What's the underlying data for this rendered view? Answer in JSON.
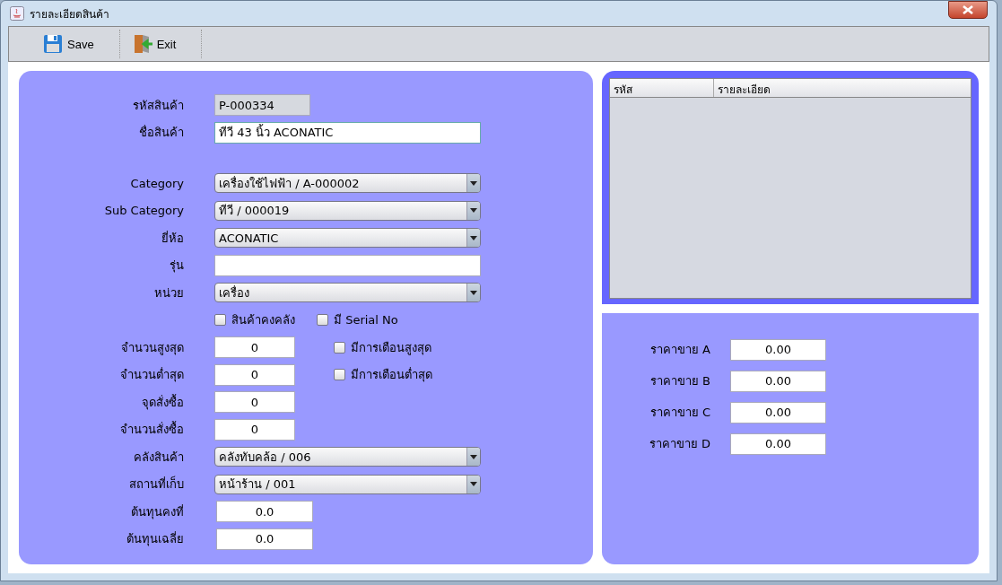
{
  "window": {
    "title": "รายละเอียดสินค้า"
  },
  "toolbar": [
    {
      "label": "Save",
      "kind": "save"
    },
    {
      "label": "Exit",
      "kind": "exit"
    }
  ],
  "product_form": {
    "identity": [
      {
        "label": "รหัสสินค้า",
        "kind": "readonly",
        "value": "P-000334"
      },
      {
        "label": "ชื่อสินค้า",
        "kind": "text",
        "value": "ทีวี 43 นิ้ว ACONATIC",
        "focused": true
      }
    ],
    "details": [
      {
        "label": "Category",
        "kind": "combo",
        "value": "เครื่องใช้ไฟฟ้า / A-000002"
      },
      {
        "label": "Sub Category",
        "kind": "combo",
        "value": "ทีวี / 000019"
      },
      {
        "label": "ยี่ห้อ",
        "kind": "combo",
        "value": "ACONATIC"
      },
      {
        "label": "รุ่น",
        "kind": "text"
      },
      {
        "label": "หน่วย",
        "kind": "combo",
        "value": "เครื่อง"
      },
      {
        "kind": "checks",
        "checkboxes": [
          {
            "label": "สินค้าคงคลัง",
            "checked": false
          },
          {
            "label": "มี Serial No",
            "checked": false
          }
        ]
      },
      {
        "label": "จำนวนสูงสุด",
        "kind": "number",
        "value": "0",
        "checkbox": {
          "label": "มีการเตือนสูงสุด",
          "checked": false
        }
      },
      {
        "label": "จำนวนต่ำสุด",
        "kind": "number",
        "value": "0",
        "checkbox": {
          "label": "มีการเตือนต่ำสุด",
          "checked": false
        }
      },
      {
        "label": "จุดสั่งซื้อ",
        "kind": "number",
        "value": "0"
      },
      {
        "label": "จำนวนสั่งซื้อ",
        "kind": "number",
        "value": "0"
      },
      {
        "label": "คลังสินค้า",
        "kind": "combo",
        "value": "คลังทับคล้อ / 006"
      },
      {
        "label": "สถานที่เก็บ",
        "kind": "combo",
        "value": "หน้าร้าน / 001"
      },
      {
        "label": "ต้นทุนคงที่",
        "kind": "cost",
        "value": "0.0"
      },
      {
        "label": "ต้นทุนเฉลี่ย",
        "kind": "cost",
        "value": "0.0"
      }
    ]
  },
  "table": {
    "columns": [
      "รหัส",
      "รายละเอียด"
    ]
  },
  "prices": [
    {
      "label": "ราคาขาย A",
      "value": "0.00"
    },
    {
      "label": "ราคาขาย B",
      "value": "0.00"
    },
    {
      "label": "ราคาขาย C",
      "value": "0.00"
    },
    {
      "label": "ราคาขาย D",
      "value": "0.00"
    }
  ]
}
